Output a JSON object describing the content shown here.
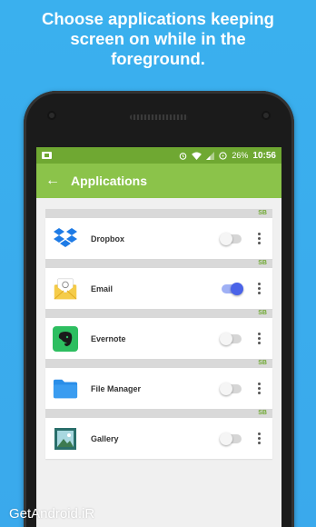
{
  "headline": "Choose applications keeping screen on while in the foreground.",
  "status_bar": {
    "battery": "26%",
    "time": "10:56"
  },
  "app_bar": {
    "title": "Applications"
  },
  "size_unit": "SB",
  "apps": [
    {
      "name": "Dropbox",
      "enabled": false,
      "icon": "dropbox-icon",
      "color": "#1e7be6"
    },
    {
      "name": "Email",
      "enabled": true,
      "icon": "email-icon",
      "color": "#f1c232"
    },
    {
      "name": "Evernote",
      "enabled": false,
      "icon": "evernote-icon",
      "color": "#2dbe60"
    },
    {
      "name": "File Manager",
      "enabled": false,
      "icon": "folder-icon",
      "color": "#2a8ee8"
    },
    {
      "name": "Gallery",
      "enabled": false,
      "icon": "gallery-icon",
      "color": "#2a6f6b"
    }
  ],
  "watermark": "GetAndroid.iR",
  "colors": {
    "background": "#3ab0ee",
    "status_bar": "#6fa832",
    "app_bar": "#8bc34a",
    "toggle_on": "#4a63e8"
  }
}
